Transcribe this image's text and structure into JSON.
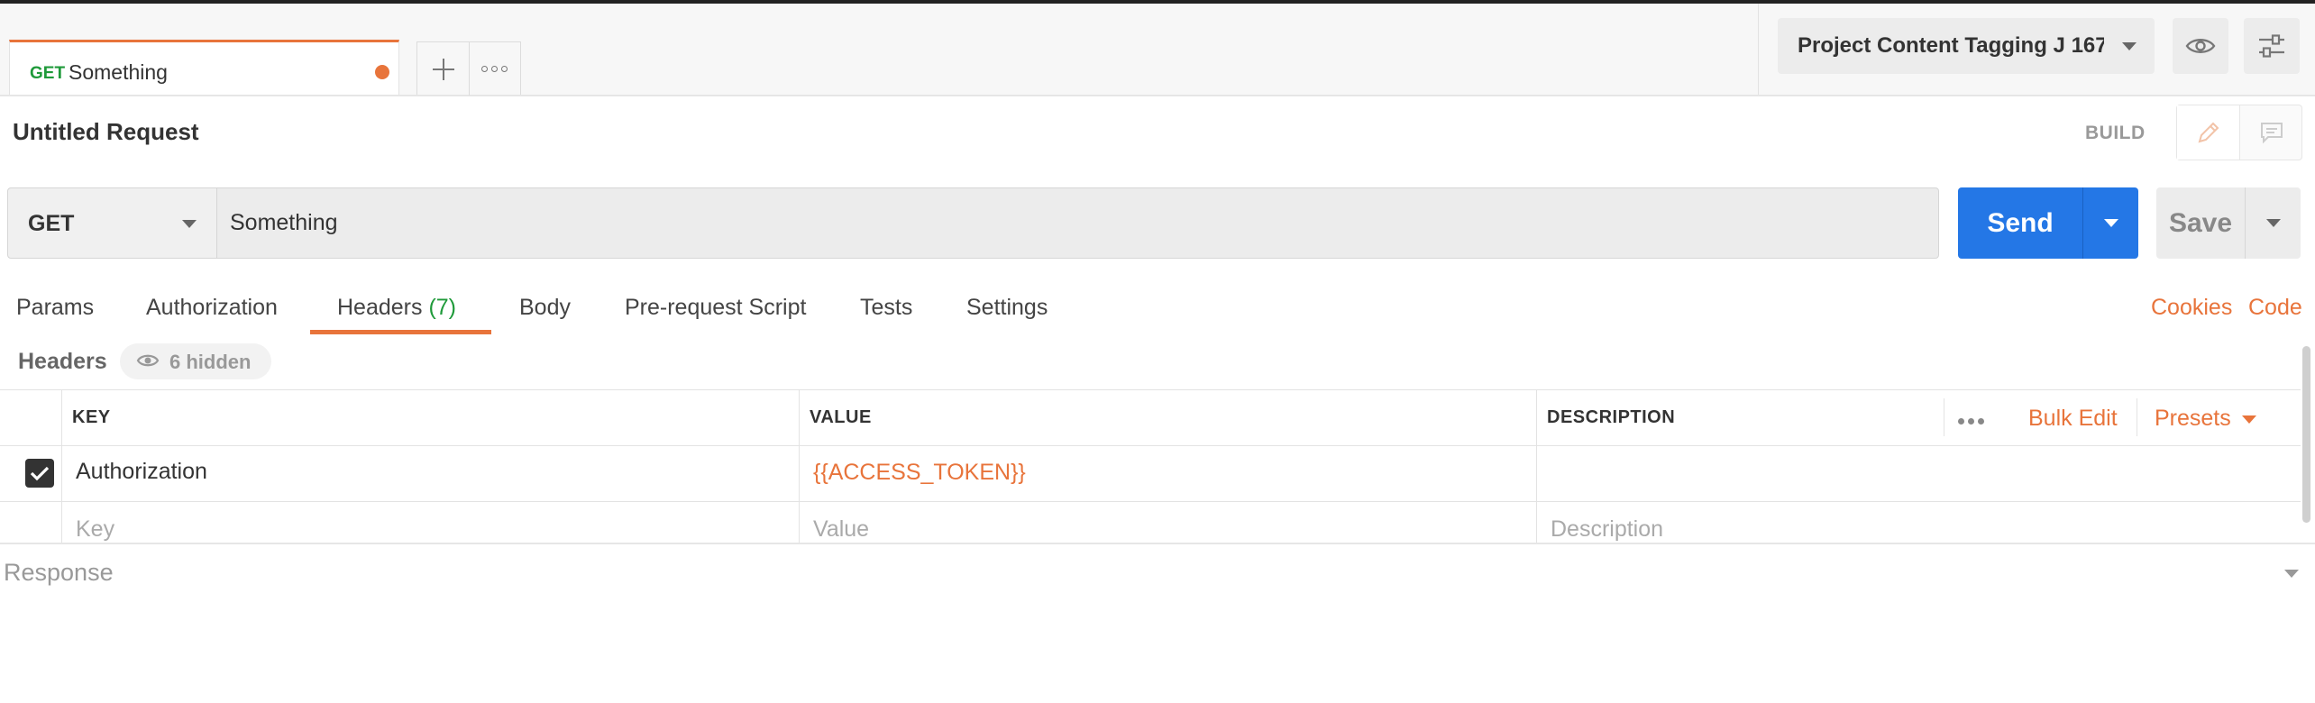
{
  "tab": {
    "method": "GET",
    "name": "Something"
  },
  "environment": {
    "selected": "Project Content Tagging J 167"
  },
  "request": {
    "title": "Untitled Request",
    "mode": "BUILD",
    "method": "GET",
    "url": "Something",
    "send_label": "Send",
    "save_label": "Save"
  },
  "subtabs": [
    {
      "label": "Params"
    },
    {
      "label": "Authorization"
    },
    {
      "label": "Headers",
      "count": "(7)"
    },
    {
      "label": "Body"
    },
    {
      "label": "Pre-request Script"
    },
    {
      "label": "Tests"
    },
    {
      "label": "Settings"
    }
  ],
  "links": {
    "cookies": "Cookies",
    "code": "Code"
  },
  "headers_section": {
    "title": "Headers",
    "hidden": "6 hidden",
    "columns": {
      "key": "KEY",
      "value": "VALUE",
      "description": "DESCRIPTION"
    },
    "bulk_edit": "Bulk Edit",
    "presets": "Presets",
    "rows": [
      {
        "checked": true,
        "key": "Authorization",
        "value": "{{ACCESS_TOKEN}}",
        "description": ""
      }
    ],
    "placeholders": {
      "key": "Key",
      "value": "Value",
      "description": "Description"
    }
  },
  "response": {
    "label": "Response"
  },
  "colors": {
    "accent": "#e8743b",
    "send": "#2477e6",
    "method_get": "#1f9a3a"
  }
}
